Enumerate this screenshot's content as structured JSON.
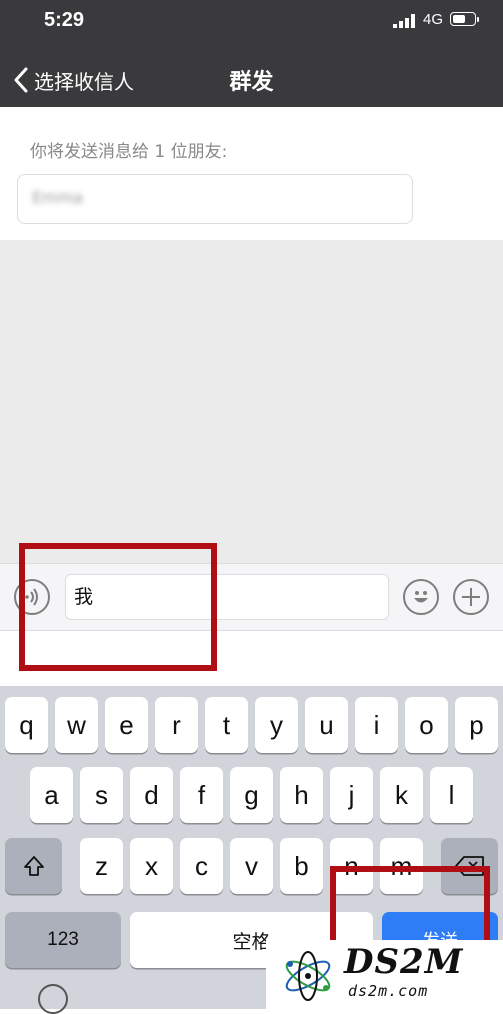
{
  "status": {
    "time": "5:29",
    "network": "4G",
    "battery_level": 0.65
  },
  "nav": {
    "back_label": "选择收信人",
    "title": "群发"
  },
  "recipients": {
    "label": "你将发送消息给 1 位朋友:",
    "name": "Emma"
  },
  "input": {
    "value": "我"
  },
  "keyboard": {
    "row1": [
      "q",
      "w",
      "e",
      "r",
      "t",
      "y",
      "u",
      "i",
      "o",
      "p"
    ],
    "row2": [
      "a",
      "s",
      "d",
      "f",
      "g",
      "h",
      "j",
      "k",
      "l"
    ],
    "row3": [
      "z",
      "x",
      "c",
      "v",
      "b",
      "n",
      "m"
    ],
    "numbers_label": "123",
    "space_label": "空格",
    "send_label": "发送"
  },
  "watermark": {
    "main": "DS2M",
    "sub": "ds2m.com"
  },
  "colors": {
    "bar": "#3a3a3c",
    "send": "#2f7df6",
    "annotation": "#b00e14"
  }
}
